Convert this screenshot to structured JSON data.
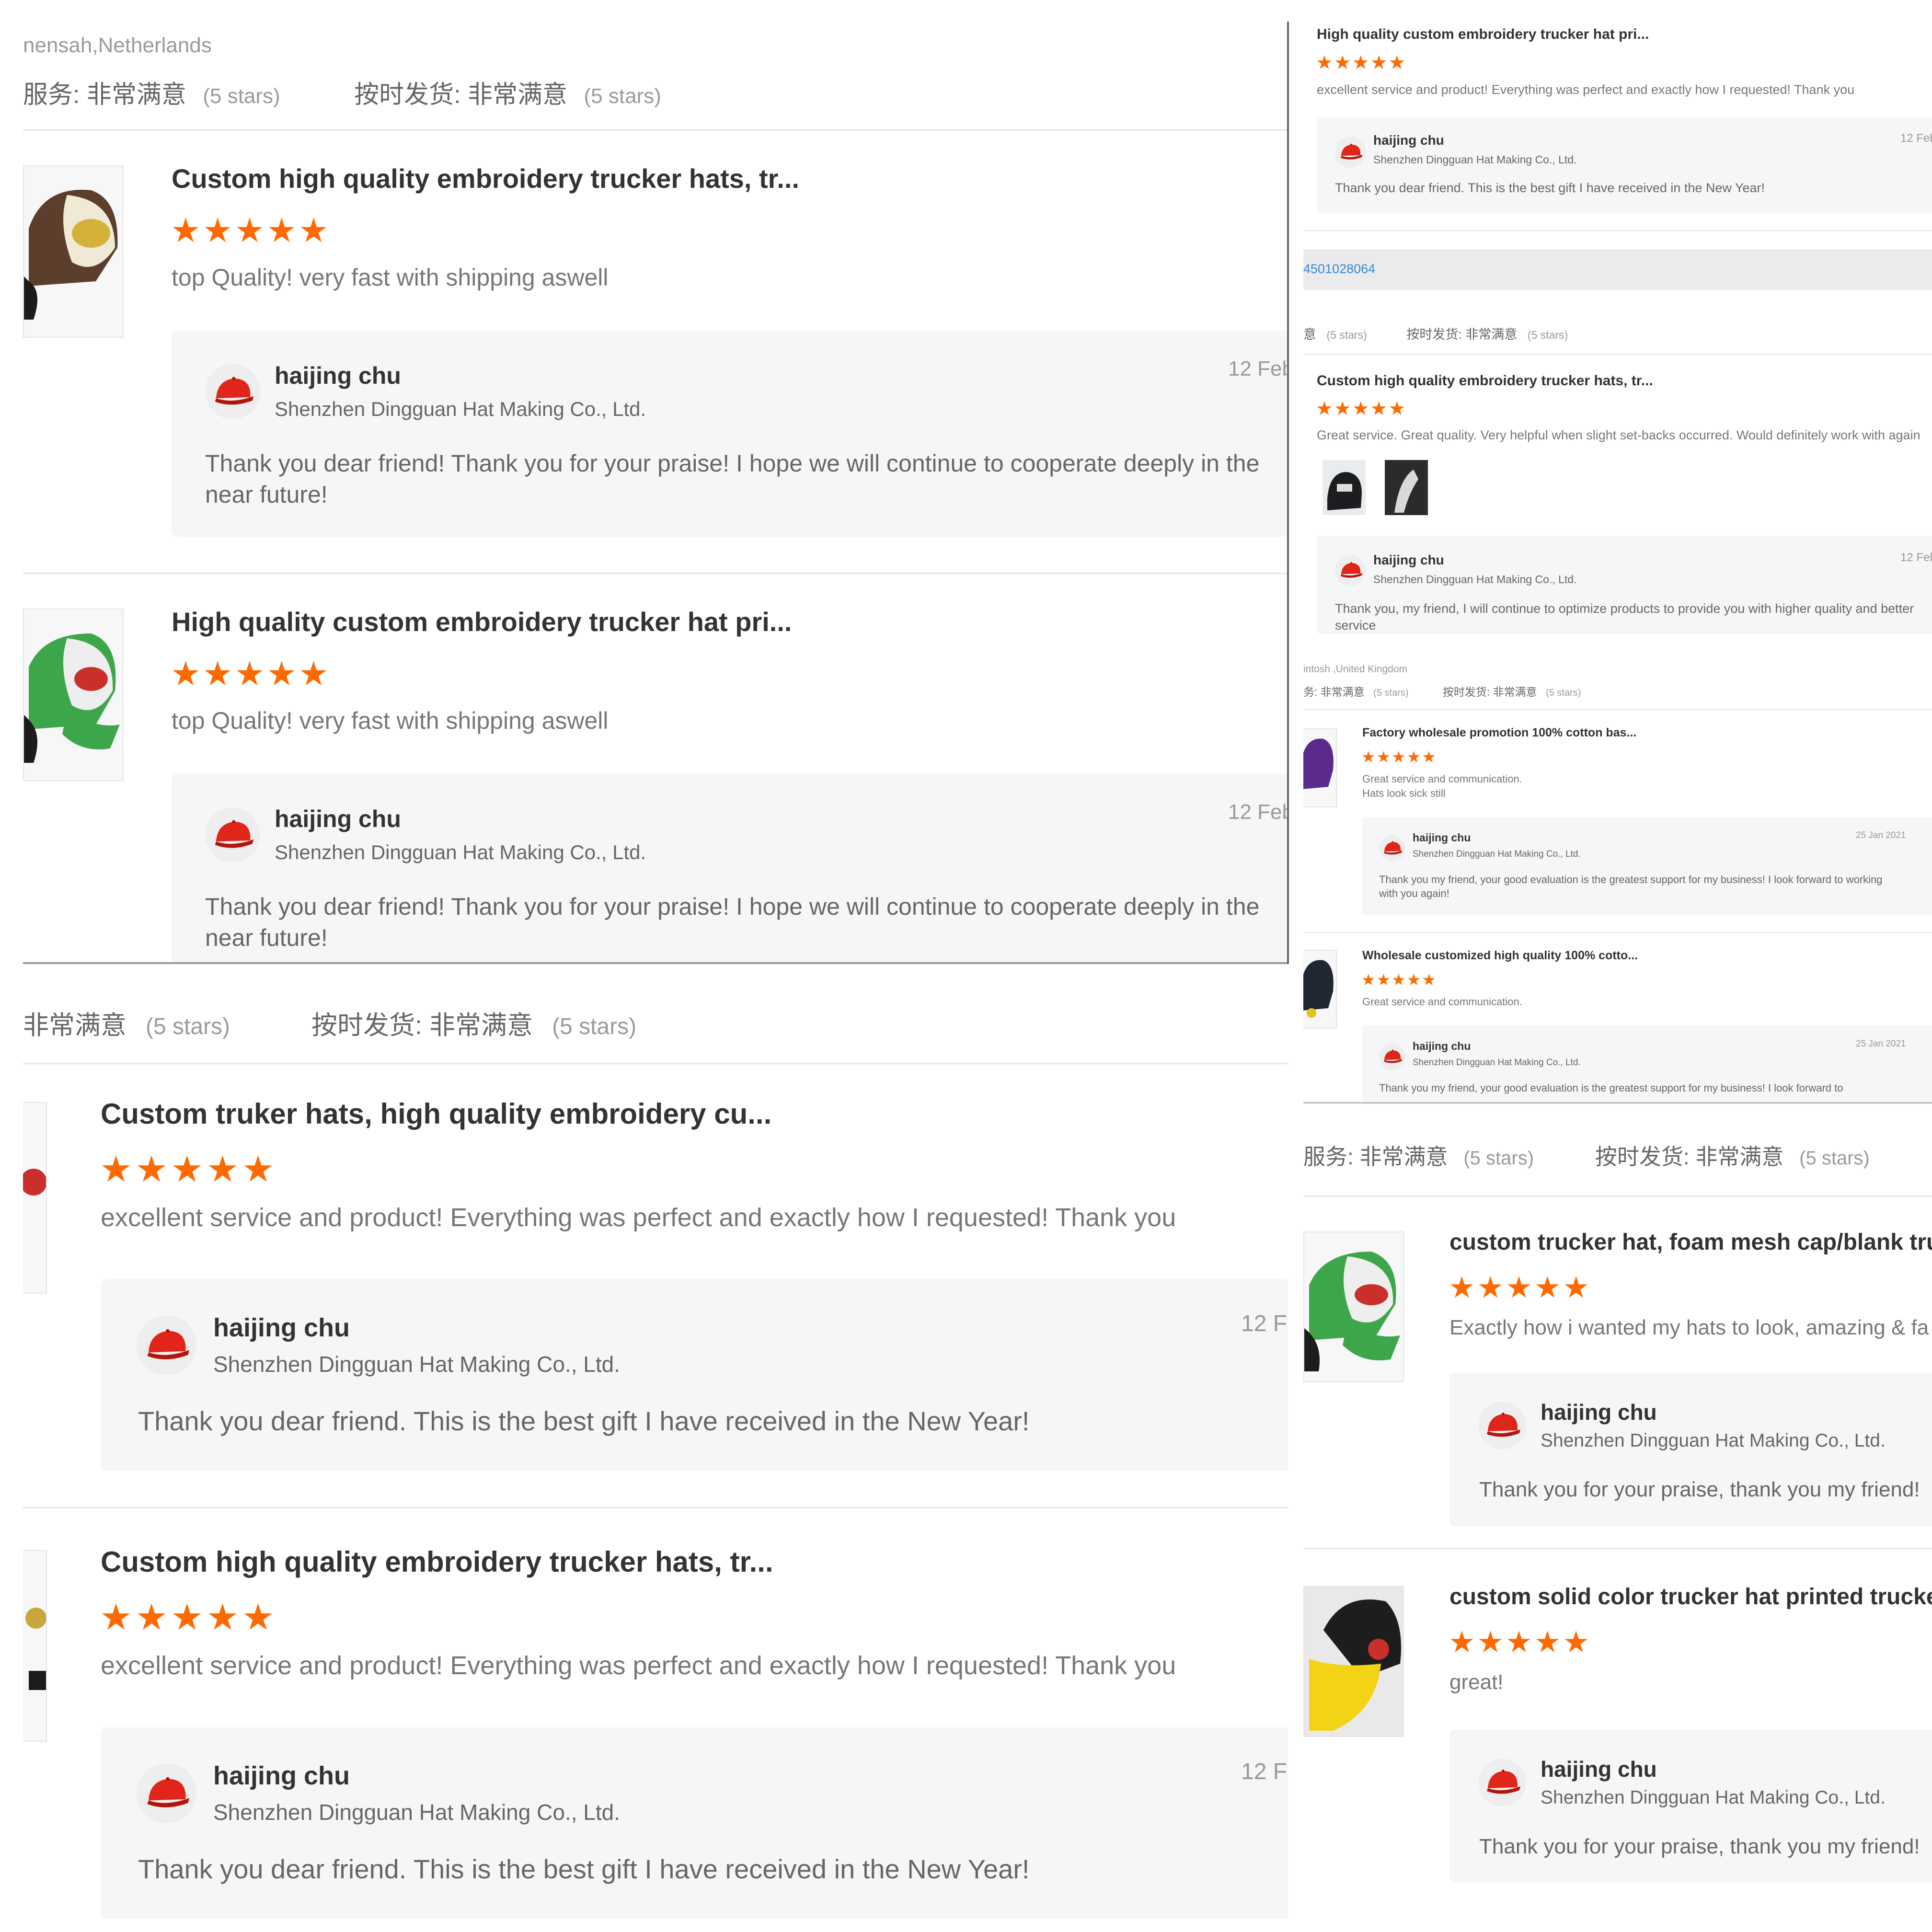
{
  "colors": {
    "star": "#ff6a00",
    "reply_bg": "#f5f6f8",
    "link": "#3a86d6"
  },
  "icons": {
    "star": "star-icon",
    "avatar": "red-cap-avatar-icon"
  },
  "panel_a": {
    "buyer": "nensah,Netherlands",
    "ratings": [
      {
        "label": "服务: 非常满意",
        "value": "(5 stars)"
      },
      {
        "label": "按时发货: 非常满意",
        "value": "(5 stars)"
      }
    ],
    "reviews": [
      {
        "title": "Custom high quality embroidery trucker hats, tr...",
        "stars": "★★★★★",
        "rating": 5,
        "text": "top Quality! very fast with shipping aswell",
        "reply": {
          "name": "haijing chu",
          "company": "Shenzhen Dingguan Hat Making Co., Ltd.",
          "date": "12 Feb",
          "message": "Thank you dear friend! Thank you for your praise! I hope we will continue to cooperate deeply in the near future!"
        }
      },
      {
        "title": "High quality custom embroidery trucker hat pri...",
        "stars": "★★★★★",
        "rating": 5,
        "text": "top Quality! very fast with shipping aswell",
        "reply": {
          "name": "haijing chu",
          "company": "Shenzhen Dingguan Hat Making Co., Ltd.",
          "date": "12 Feb",
          "message": "Thank you dear friend! Thank you for your praise! I hope we will continue to cooperate deeply in the near future!"
        }
      }
    ]
  },
  "panel_b": {
    "ratings": [
      {
        "label": "非常满意",
        "value": "(5 stars)"
      },
      {
        "label": "按时发货: 非常满意",
        "value": "(5 stars)"
      }
    ],
    "reviews": [
      {
        "title": "Custom truker hats, high quality embroidery cu...",
        "stars": "★★★★★",
        "rating": 5,
        "text": "excellent service and product! Everything was perfect and exactly how I requested! Thank you",
        "reply": {
          "name": "haijing chu",
          "company": "Shenzhen Dingguan Hat Making Co., Ltd.",
          "date": "12 F",
          "message": "Thank you dear friend. This is the best gift I have received in the New Year!"
        }
      },
      {
        "title": "Custom high quality embroidery trucker hats, tr...",
        "stars": "★★★★★",
        "rating": 5,
        "text": "excellent service and product! Everything was perfect and exactly how I requested! Thank you",
        "reply": {
          "name": "haijing chu",
          "company": "Shenzhen Dingguan Hat Making Co., Ltd.",
          "date": "12 F",
          "message": "Thank you dear friend. This is the best gift I have received in the New Year!"
        }
      }
    ]
  },
  "panel_c": {
    "top_review": {
      "title": "High quality custom embroidery trucker hat pri...",
      "stars": "★★★★★",
      "rating": 5,
      "text": "excellent service and product! Everything was perfect and exactly how I requested! Thank you",
      "reply": {
        "name": "haijing chu",
        "company": "Shenzhen Dingguan Hat Making Co., Ltd.",
        "date": "12 Feb",
        "message": "Thank you dear friend. This is the best gift I have received in the New Year!"
      }
    },
    "order_no": "4501028064",
    "ratings": [
      {
        "label": "意",
        "value": "(5 stars)"
      },
      {
        "label": "按时发货: 非常满意",
        "value": "(5 stars)"
      }
    ],
    "review2": {
      "title": "Custom high quality embroidery trucker hats, tr...",
      "stars": "★★★★★",
      "rating": 5,
      "text": "Great service. Great quality. Very helpful when slight set-backs occurred. Would definitely work with again",
      "reply": {
        "name": "haijing chu",
        "company": "Shenzhen Dingguan Hat Making Co., Ltd.",
        "date": "12 Feb",
        "message": "Thank you, my friend, I will continue to optimize products to provide you with higher quality and better service"
      }
    },
    "buyer2": "intosh ,United Kingdom",
    "ratings2": [
      {
        "label": "务: 非常满意",
        "value": "(5 stars)"
      },
      {
        "label": "按时发货: 非常满意",
        "value": "(5 stars)"
      }
    ],
    "review3": {
      "title": "Factory wholesale promotion 100% cotton bas...",
      "stars": "★★★★★",
      "rating": 5,
      "text1": "Great service and communication.",
      "text2": "Hats look sick still",
      "reply": {
        "name": "haijing chu",
        "company": "Shenzhen Dingguan Hat Making Co., Ltd.",
        "date": "25 Jan 2021",
        "message": "Thank you my friend, your good evaluation is the greatest support for my business! I look forward to working with you again!"
      }
    },
    "review4": {
      "title": "Wholesale customized high quality 100% cotto...",
      "stars": "★★★★★",
      "rating": 5,
      "text": "Great service and communication.",
      "reply": {
        "name": "haijing chu",
        "company": "Shenzhen Dingguan Hat Making Co., Ltd.",
        "date": "25 Jan 2021",
        "message": "Thank you my friend, your good evaluation is the greatest support for my business! I look forward to"
      }
    }
  },
  "panel_d": {
    "ratings": [
      {
        "label": "服务: 非常满意",
        "value": "(5 stars)"
      },
      {
        "label": "按时发货: 非常满意",
        "value": "(5 stars)"
      }
    ],
    "reviews": [
      {
        "title": "custom trucker hat, foam mesh cap/blank tru",
        "stars": "★★★★★",
        "rating": 5,
        "text": "Exactly how i wanted my hats to look, amazing & fa",
        "reply": {
          "name": "haijing chu",
          "company": "Shenzhen Dingguan Hat Making Co., Ltd.",
          "message": "Thank you for your praise, thank you my friend!"
        }
      },
      {
        "title": "custom solid color trucker hat printed trucke",
        "stars": "★★★★★",
        "rating": 5,
        "text": "great!",
        "reply": {
          "name": "haijing chu",
          "company": "Shenzhen Dingguan Hat Making Co., Ltd.",
          "message": "Thank you for your praise, thank you my friend!"
        }
      }
    ]
  }
}
